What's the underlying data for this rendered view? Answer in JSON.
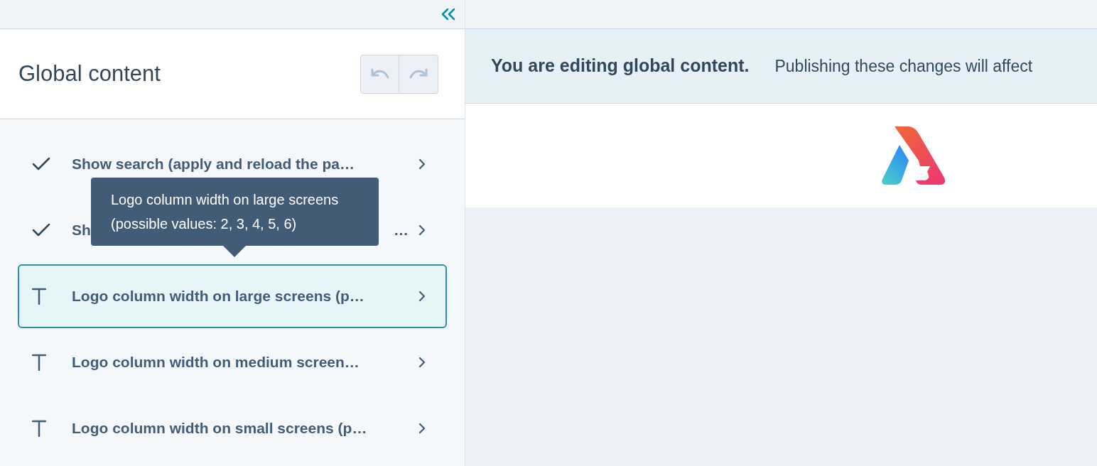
{
  "sidebar": {
    "title": "Global content",
    "undo": {
      "disabled": true
    },
    "redo": {
      "disabled": true
    },
    "items": [
      {
        "kind": "checkbox",
        "label": "Show search (apply and reload the pa…",
        "selected": false
      },
      {
        "kind": "checkbox",
        "label": "Sh",
        "label_end": "…",
        "selected": false
      },
      {
        "kind": "text",
        "label": "Logo column width on large screens (p…",
        "selected": true
      },
      {
        "kind": "text",
        "label": "Logo column width on medium screen…",
        "selected": false
      },
      {
        "kind": "text",
        "label": "Logo column width on small screens (p…",
        "selected": false
      }
    ],
    "tooltip": {
      "text": "Logo column width on large screens (possible values: 2, 3, 4, 5, 6)"
    }
  },
  "banner": {
    "title": "You are editing global content.",
    "message": "Publishing these changes will affect"
  }
}
